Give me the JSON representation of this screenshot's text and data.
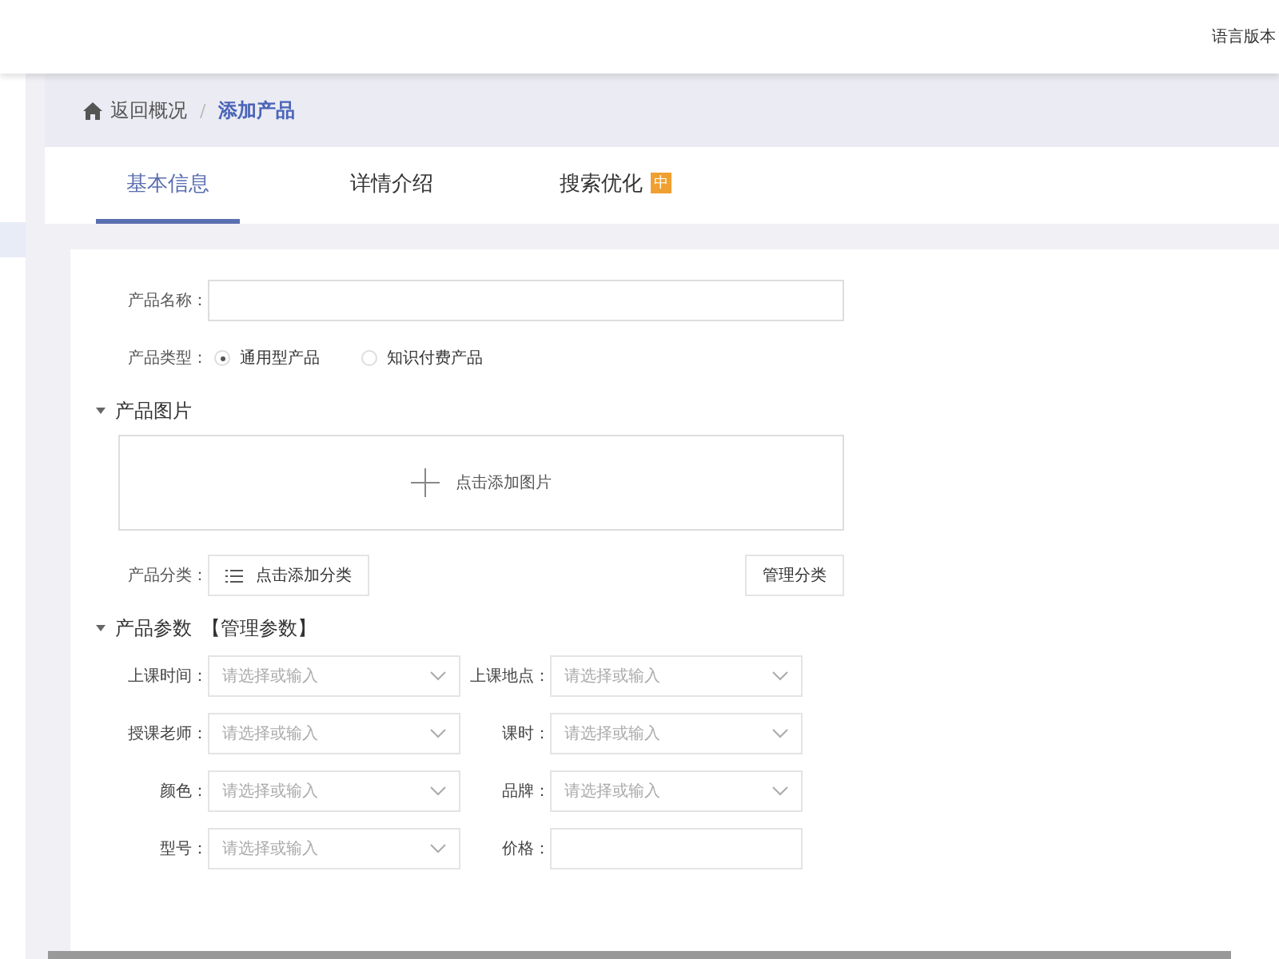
{
  "header": {
    "language": "语言版本"
  },
  "sidebar": {
    "items": [
      {
        "selected": true
      }
    ]
  },
  "breadcrumb": {
    "back": "返回概况",
    "separator": "/",
    "current": "添加产品"
  },
  "tabs": [
    {
      "label": "基本信息",
      "selected": true
    },
    {
      "label": "详情介绍",
      "selected": false
    },
    {
      "label": "搜索优化",
      "selected": false,
      "badge": "中"
    }
  ],
  "form": {
    "name_label": "产品名称：",
    "type_label": "产品类型：",
    "types": [
      {
        "label": "通用型产品",
        "selected": true
      },
      {
        "label": "知识付费产品",
        "selected": false
      }
    ],
    "images_section": {
      "title": "产品图片",
      "expanded": true,
      "add": "点击添加图片"
    },
    "category_label": "产品分类：",
    "category_add": "点击添加分类",
    "category_manage": "管理分类",
    "params_section": {
      "title": "产品参数",
      "expanded": true,
      "manage": "【管理参数】"
    },
    "params": [
      {
        "label": "上课时间：",
        "kind": "select",
        "placeholder": "请选择或输入"
      },
      {
        "label": "上课地点：",
        "kind": "select",
        "placeholder": "请选择或输入"
      },
      {
        "label": "授课老师：",
        "kind": "select",
        "placeholder": "请选择或输入"
      },
      {
        "label": "课时：",
        "kind": "select",
        "placeholder": "请选择或输入"
      },
      {
        "label": "颜色：",
        "kind": "select",
        "placeholder": "请选择或输入"
      },
      {
        "label": "品牌：",
        "kind": "select",
        "placeholder": "请选择或输入"
      },
      {
        "label": "型号：",
        "kind": "select",
        "placeholder": "请选择或输入"
      },
      {
        "label": "价格：",
        "kind": "text"
      }
    ]
  }
}
